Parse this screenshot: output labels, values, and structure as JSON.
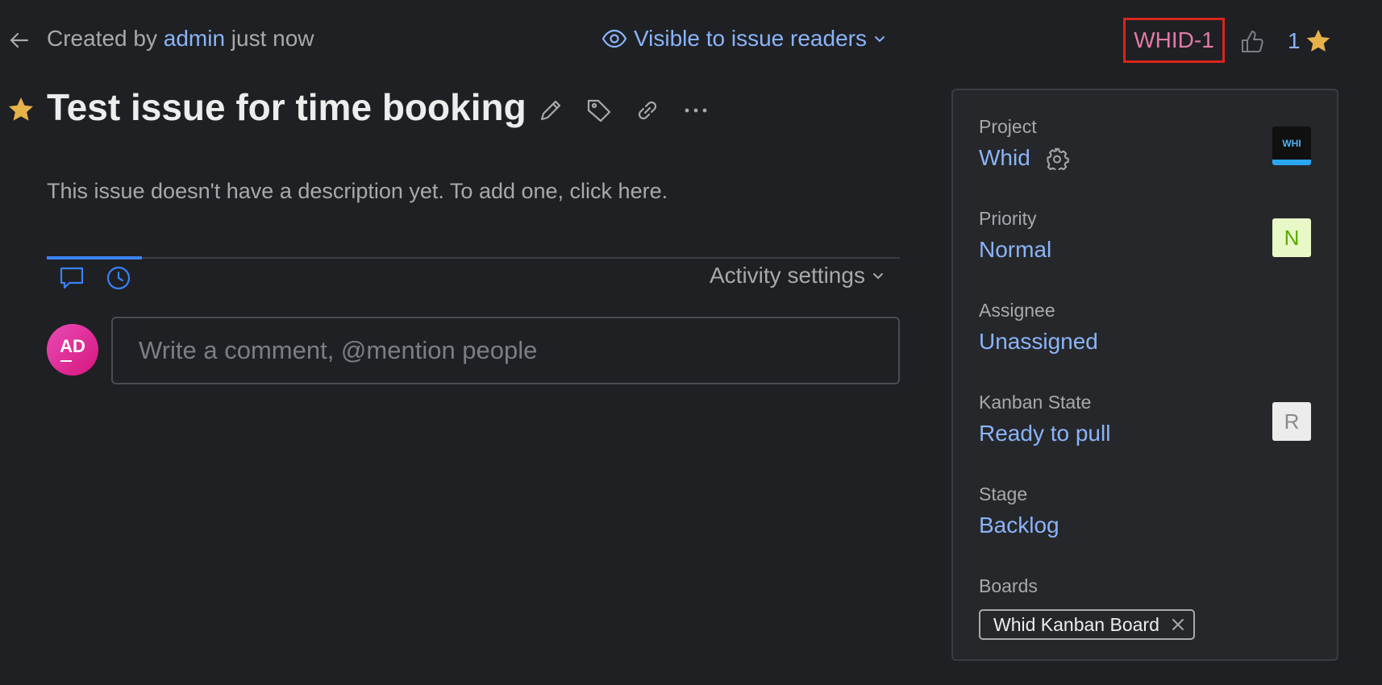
{
  "header": {
    "created_prefix": "Created by",
    "created_user": "admin",
    "created_suffix": "just now",
    "visibility": "Visible to issue readers",
    "issue_id": "WHID-1",
    "vote_count": "1"
  },
  "issue": {
    "title": "Test issue for time booking",
    "description_placeholder": "This issue doesn't have a description yet. To add one, click here."
  },
  "activity": {
    "settings_label": "Activity settings",
    "avatar_initials": "AD",
    "comment_placeholder": "Write a comment, @mention people"
  },
  "fields": {
    "project": {
      "label": "Project",
      "value": "Whid",
      "badge": "WHI"
    },
    "priority": {
      "label": "Priority",
      "value": "Normal",
      "badge": "N",
      "badge_bg": "#e8f8c6",
      "badge_fg": "#5aa800"
    },
    "assignee": {
      "label": "Assignee",
      "value": "Unassigned"
    },
    "kanban_state": {
      "label": "Kanban State",
      "value": "Ready to pull",
      "badge": "R",
      "badge_bg": "#ececec",
      "badge_fg": "#8a8a8a"
    },
    "stage": {
      "label": "Stage",
      "value": "Backlog"
    },
    "boards": {
      "label": "Boards",
      "items": [
        "Whid Kanban Board"
      ]
    }
  },
  "colors": {
    "background": "#1f2024",
    "link": "#8ab4f8",
    "issue_id": "#e27aa8",
    "highlight_box": "#d9251c",
    "star": "#e7b24a",
    "accent_tab": "#3b82f6"
  },
  "icons": [
    "back-arrow-icon",
    "eye-icon",
    "chevron-down-icon",
    "thumb-up-icon",
    "star-icon",
    "pencil-icon",
    "tag-icon",
    "link-icon",
    "more-icon",
    "comment-icon",
    "clock-icon",
    "gear-icon",
    "close-icon"
  ]
}
